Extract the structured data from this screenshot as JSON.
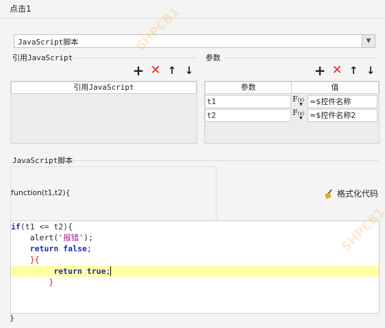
{
  "title": "点击1",
  "script_select": {
    "value": "JavaScript脚本"
  },
  "refs": {
    "group_label": "引用JavaScript",
    "column": "引用JavaScript"
  },
  "params": {
    "group_label": "参数",
    "col_name": "参数",
    "col_value": "值",
    "rows": [
      {
        "name": "t1",
        "fx": "F",
        "fx_sub": "(x)",
        "value": "=$控件名称"
      },
      {
        "name": "t2",
        "fx": "F",
        "fx_sub": "(x)",
        "value": "=$控件名称2"
      }
    ]
  },
  "script": {
    "group_label": "JavaScript脚本",
    "header_line": "function(t1,t2){",
    "format_label": "格式化代码",
    "footer_line": "}"
  },
  "code": {
    "l1_kw": "if",
    "l1_rest": "(t1 <= t2){",
    "l2_a": "    alert(",
    "l2_str": "'报错'",
    "l2_b": ");",
    "l3_kw": "return",
    "l3_kw2": "false",
    "l3_end": ";",
    "l4": "    }{",
    "l5_kw": "return",
    "l5_kw2": "true",
    "l5_end": ";",
    "l6": "        }"
  },
  "watermark": "SHPCB1"
}
